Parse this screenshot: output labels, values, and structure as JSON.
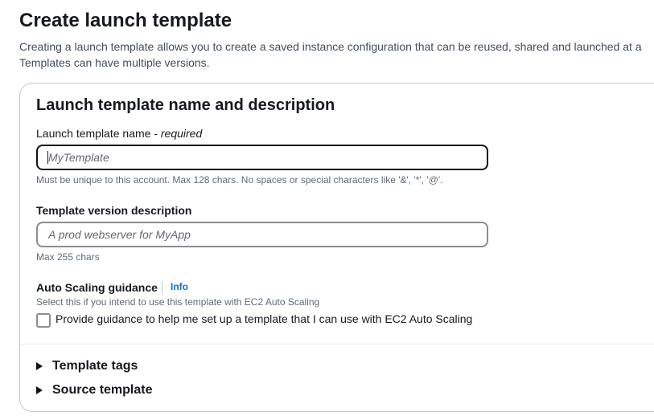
{
  "page": {
    "title": "Create launch template",
    "description_line1": "Creating a launch template allows you to create a saved instance configuration that can be reused, shared and launched at a",
    "description_line2": "Templates can have multiple versions."
  },
  "panel": {
    "title": "Launch template name and description",
    "name_field": {
      "label": "Launch template name - ",
      "label_required": "required",
      "placeholder": "MyTemplate",
      "value": "",
      "hint": "Must be unique to this account. Max 128 chars. No spaces or special characters like '&', '*', '@'."
    },
    "description_field": {
      "label": "Template version description",
      "placeholder": "A prod webserver for MyApp",
      "value": "",
      "hint": "Max 255 chars"
    },
    "auto_scaling": {
      "label": "Auto Scaling guidance",
      "info_link": "Info",
      "hint": "Select this if you intend to use this template with EC2 Auto Scaling",
      "checkbox_label": "Provide guidance to help me set up a template that I can use with EC2 Auto Scaling",
      "checked": false
    },
    "expanders": [
      {
        "label": "Template tags",
        "icon": "caret-right-icon"
      },
      {
        "label": "Source template",
        "icon": "caret-right-icon"
      }
    ]
  },
  "colors": {
    "text": "#16191f",
    "secondary_text": "#414d5c",
    "hint_text": "#5f6b7a",
    "link": "#0972d3",
    "focused_border": "#0f141a",
    "input_border": "#8c8c94",
    "panel_border": "#c6c6cd"
  }
}
